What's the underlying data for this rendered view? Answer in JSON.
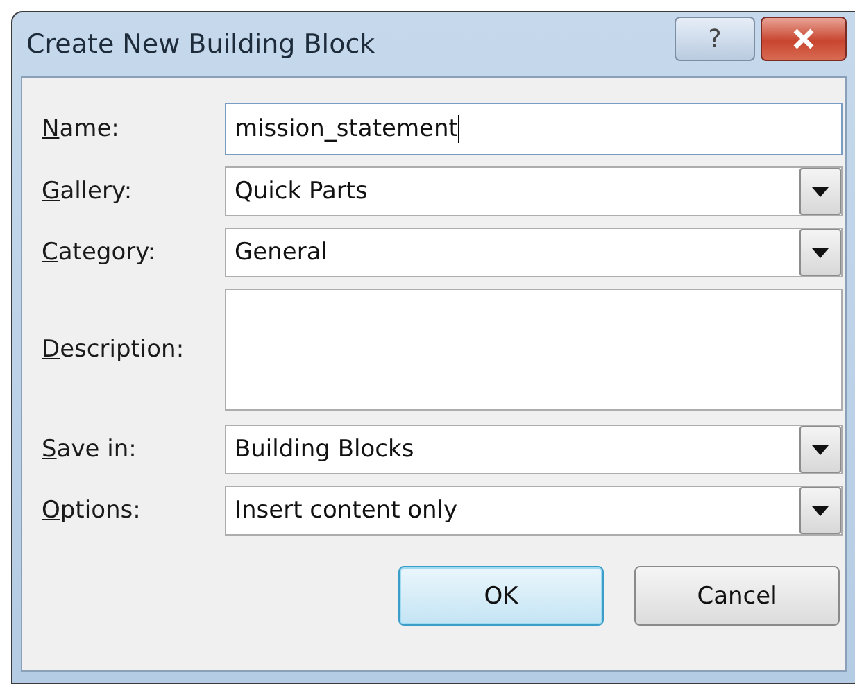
{
  "window": {
    "title": "Create New Building Block",
    "help_button": "?"
  },
  "fields": [
    {
      "label": "Name:",
      "kind": "text",
      "value": "mission_statement",
      "focused": true
    },
    {
      "label": "Gallery:",
      "kind": "dropdown",
      "value": "Quick Parts"
    },
    {
      "label": "Category:",
      "kind": "dropdown",
      "value": "General"
    },
    {
      "label": "Description:",
      "kind": "textarea"
    },
    {
      "label": "Save in:",
      "kind": "dropdown",
      "value": "Building Blocks"
    },
    {
      "label": "Options:",
      "kind": "dropdown",
      "value": "Insert content only"
    }
  ],
  "buttons": [
    {
      "label": "OK",
      "default": true
    },
    {
      "label": "Cancel",
      "default": false
    }
  ]
}
